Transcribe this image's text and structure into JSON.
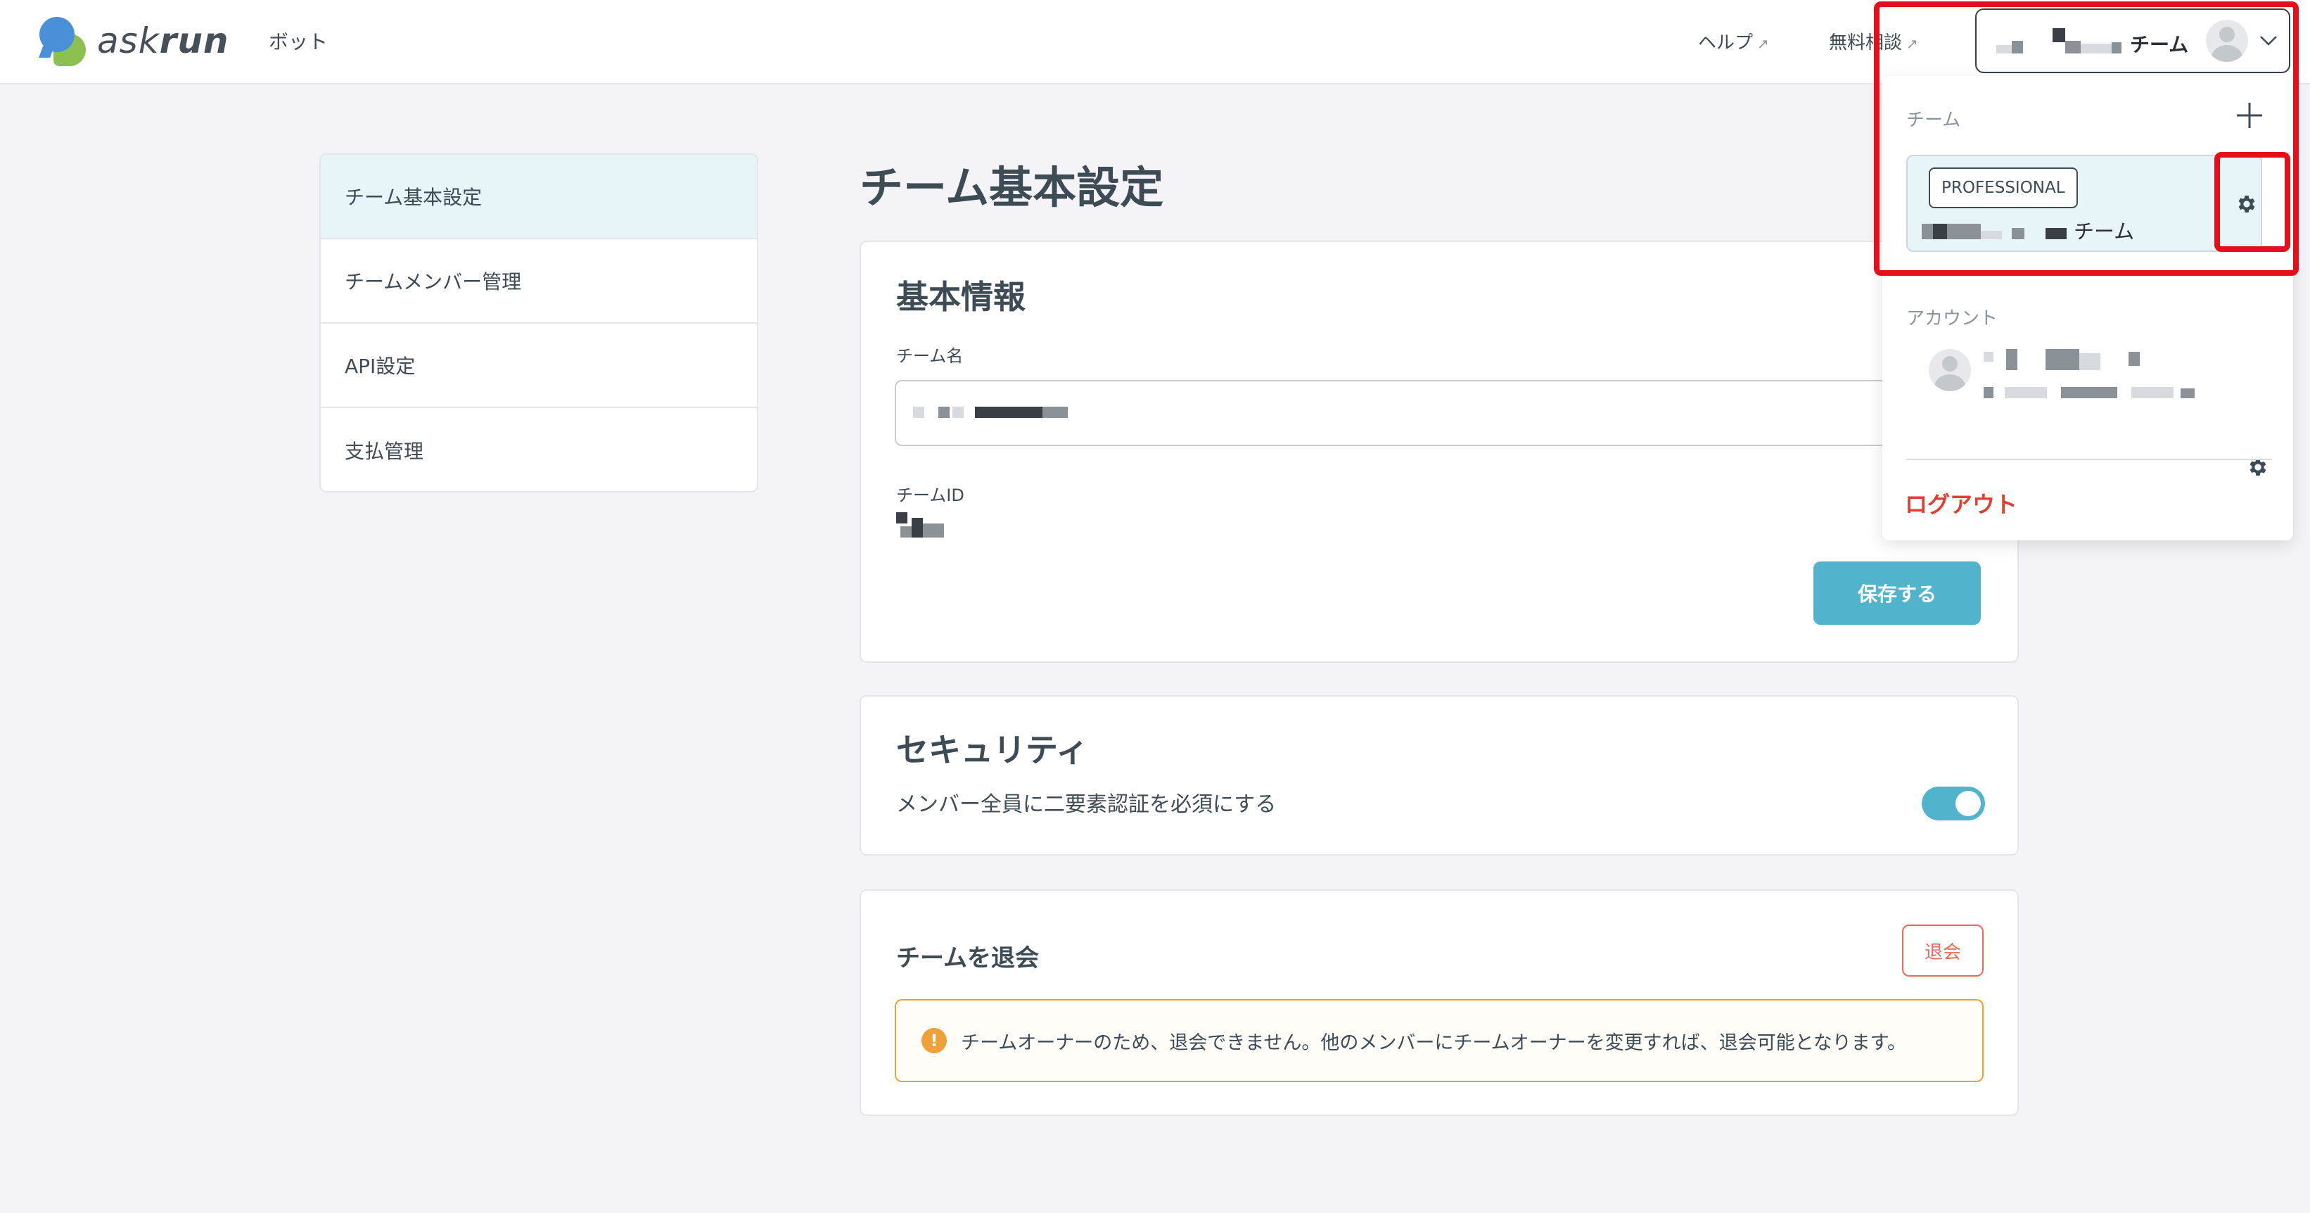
{
  "header": {
    "logo": {
      "part1": "ask",
      "part2": "run"
    },
    "nav_bot": "ボット",
    "help_link": "ヘルプ",
    "consult_link": "無料相談",
    "external_mark": "↗",
    "team_switcher": {
      "team_suffix": "チーム"
    }
  },
  "sidebar": {
    "items": [
      {
        "label": "チーム基本設定",
        "active": true
      },
      {
        "label": "チームメンバー管理",
        "active": false
      },
      {
        "label": "API設定",
        "active": false
      },
      {
        "label": "支払管理",
        "active": false
      }
    ]
  },
  "main": {
    "page_title": "チーム基本設定",
    "basic_info": {
      "title": "基本情報",
      "team_name_label": "チーム名",
      "team_id_label": "チームID",
      "save_button": "保存する"
    },
    "security": {
      "title": "セキュリティ",
      "two_factor_label": "メンバー全員に二要素認証を必須にする",
      "two_factor_enabled": true
    },
    "withdraw": {
      "title": "チームを退会",
      "button": "退会",
      "warning_icon": "!",
      "warning": "チームオーナーのため、退会できません。他のメンバーにチームオーナーを変更すれば、退会可能となります。"
    }
  },
  "dropdown": {
    "team_section_label": "チーム",
    "team_card": {
      "plan": "PROFESSIONAL",
      "team_suffix": "チーム"
    },
    "account_section_label": "アカウント",
    "logout": "ログアウト"
  },
  "icons": {
    "logo": "askrun-logo-icon",
    "chevron": "chevron-down-icon",
    "add": "plus-icon",
    "settings": "gear-icon",
    "avatar": "user-avatar-icon",
    "warning": "warning-icon"
  },
  "colors": {
    "accent": "#52b4cc",
    "danger": "#e0402f",
    "warning": "#f0a23a",
    "highlight": "#e3101a",
    "active_bg": "#e7f4f8"
  }
}
